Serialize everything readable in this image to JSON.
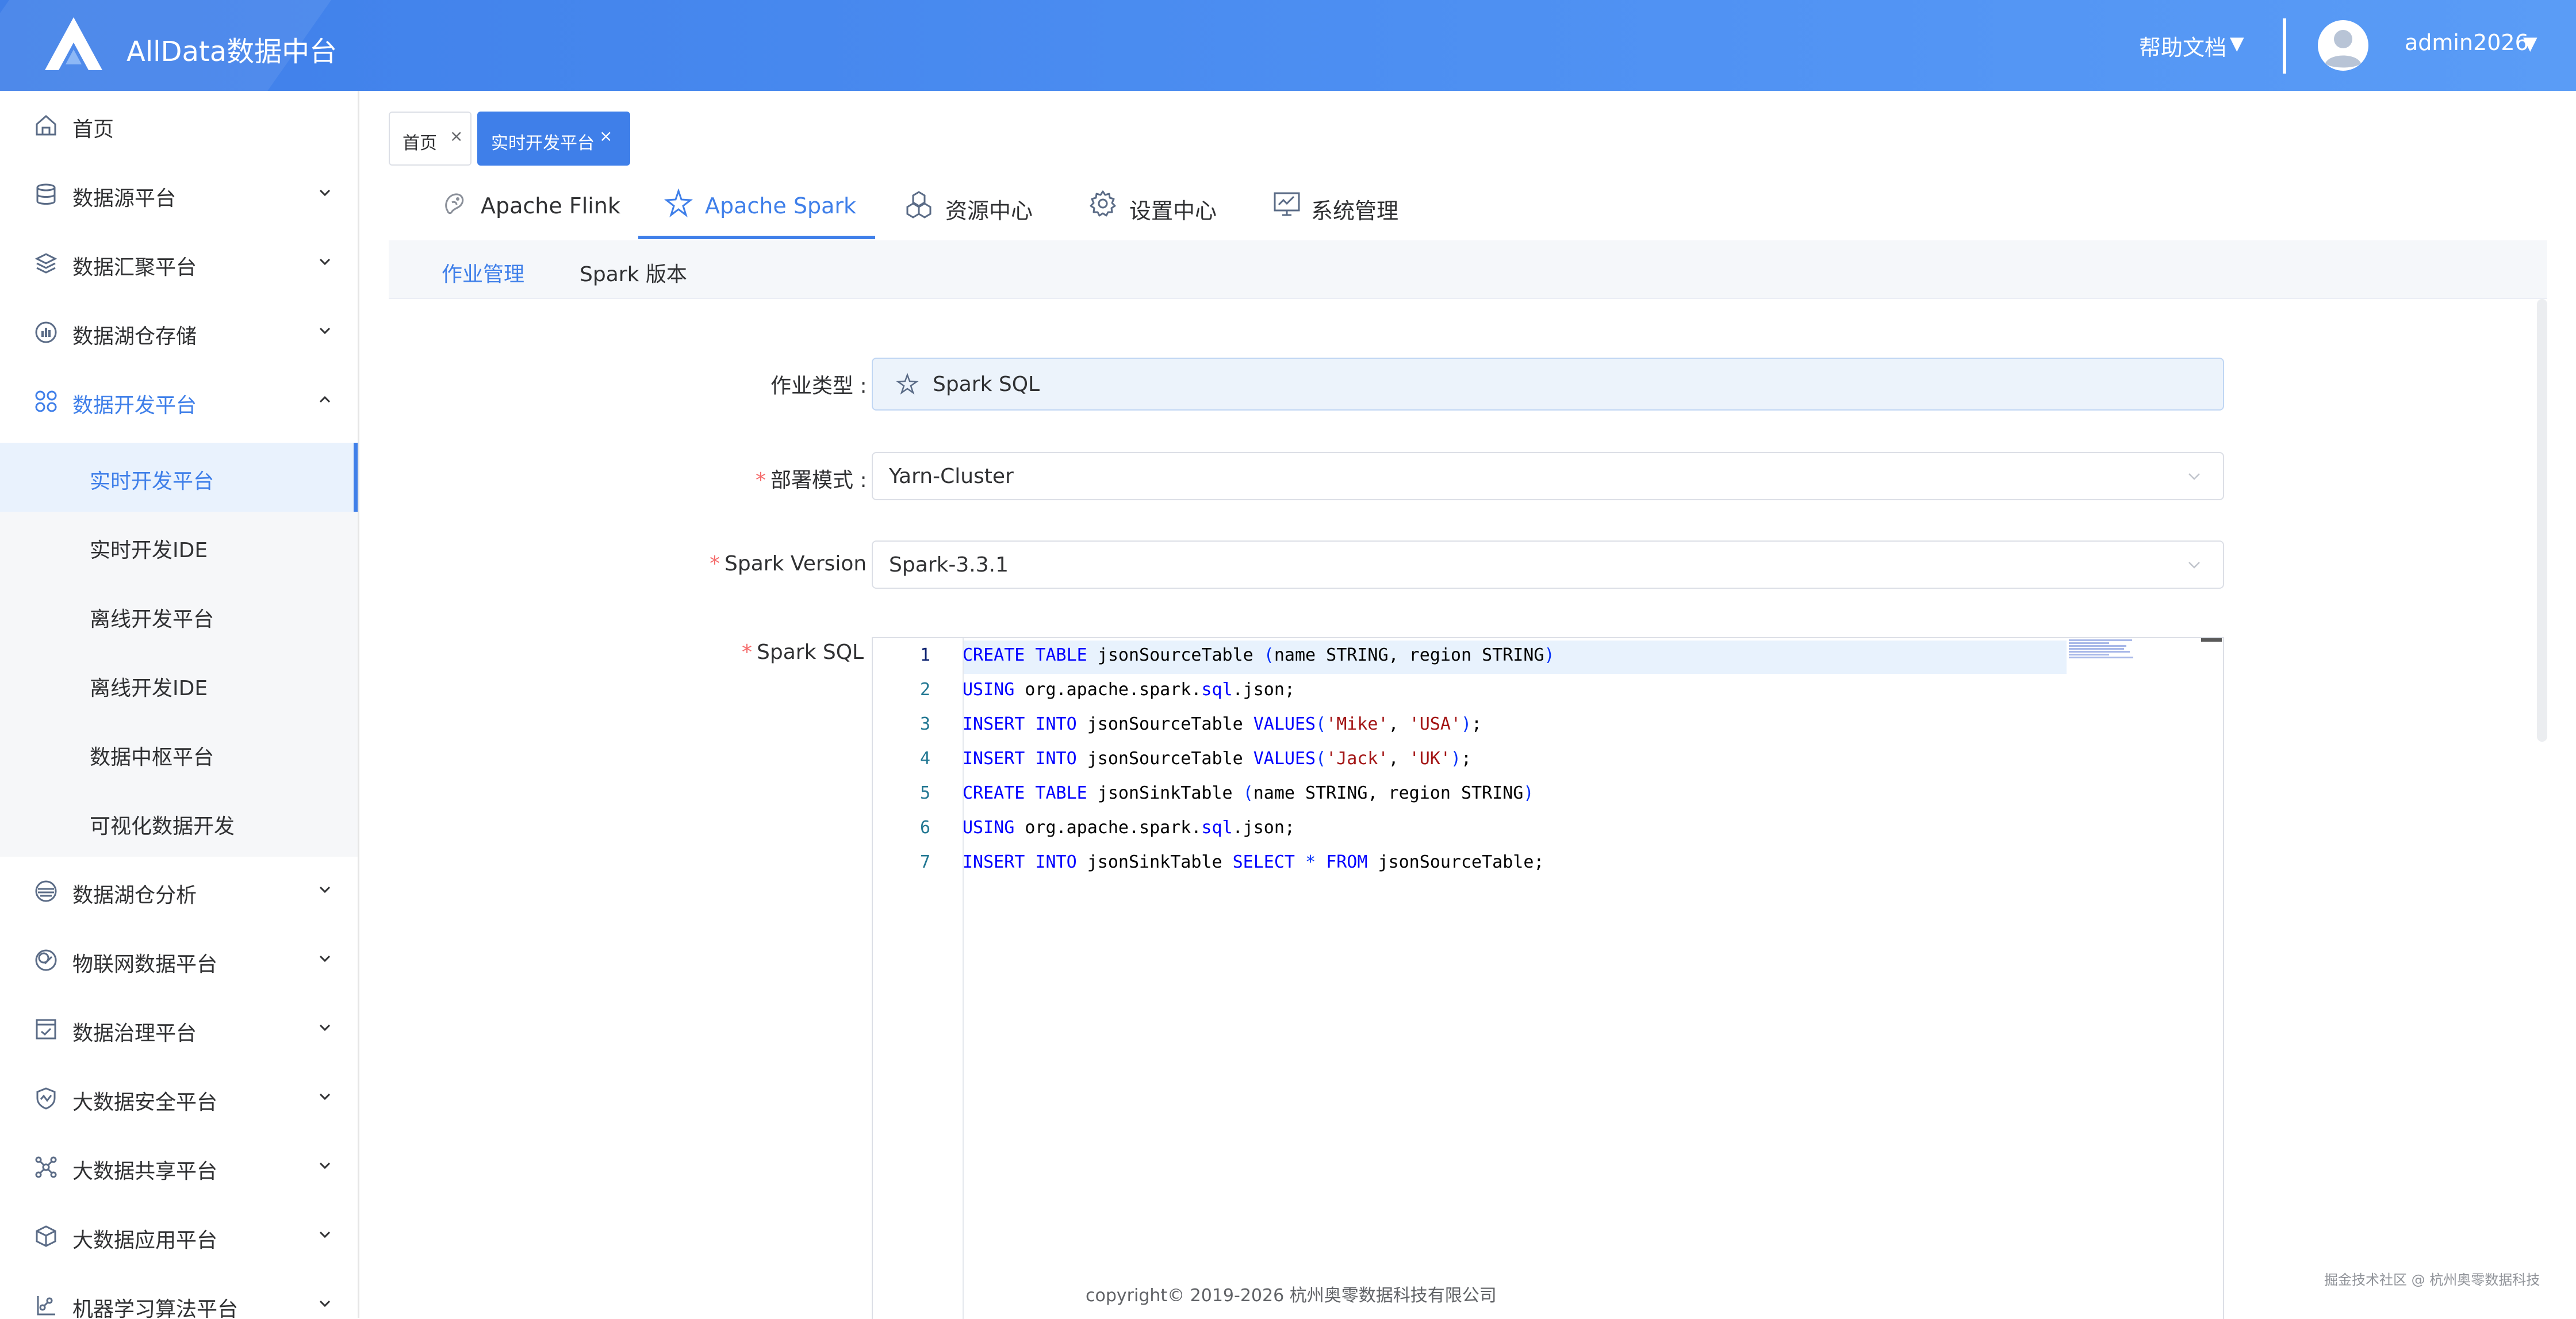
{
  "header": {
    "app_title": "AllData数据中台",
    "help_label": "帮助文档",
    "user_name": "admin2026",
    "caret": "▼"
  },
  "sidebar": {
    "items": [
      {
        "label": "首页",
        "icon": "home-icon"
      },
      {
        "label": "数据源平台",
        "icon": "database-icon"
      },
      {
        "label": "数据汇聚平台",
        "icon": "layers-icon"
      },
      {
        "label": "数据湖仓存储",
        "icon": "bar-chart-icon"
      },
      {
        "label": "数据开发平台",
        "icon": "apps-icon",
        "expanded": true
      },
      {
        "label": "数据湖仓分析",
        "icon": "lake-icon"
      },
      {
        "label": "物联网数据平台",
        "icon": "iot-icon"
      },
      {
        "label": "数据治理平台",
        "icon": "checklist-icon"
      },
      {
        "label": "大数据安全平台",
        "icon": "shield-icon"
      },
      {
        "label": "大数据共享平台",
        "icon": "share-icon"
      },
      {
        "label": "大数据应用平台",
        "icon": "cube-icon"
      },
      {
        "label": "机器学习算法平台",
        "icon": "ml-icon"
      }
    ],
    "subitems": [
      {
        "label": "实时开发平台",
        "active": true
      },
      {
        "label": "实时开发IDE"
      },
      {
        "label": "离线开发平台"
      },
      {
        "label": "离线开发IDE"
      },
      {
        "label": "数据中枢平台"
      },
      {
        "label": "可视化数据开发"
      }
    ]
  },
  "tags": {
    "home": "首页",
    "realtime": "实时开发平台",
    "close": "×"
  },
  "tabs": [
    {
      "label": "Apache Flink",
      "icon": "flink-icon"
    },
    {
      "label": "Apache Spark",
      "icon": "spark-icon",
      "active": true
    },
    {
      "label": "资源中心",
      "icon": "resource-icon"
    },
    {
      "label": "设置中心",
      "icon": "settings-icon"
    },
    {
      "label": "系统管理",
      "icon": "monitor-icon"
    }
  ],
  "subtabs": [
    {
      "label": "作业管理",
      "active": true
    },
    {
      "label": "Spark 版本"
    }
  ],
  "form": {
    "job_type": {
      "label": "作业类型 :",
      "value": "Spark SQL"
    },
    "deploy_mode": {
      "label": "部署模式 :",
      "value": "Yarn-Cluster",
      "required": "*"
    },
    "spark_version": {
      "label": "Spark Version :",
      "value": "Spark-3.3.1",
      "required": "*"
    },
    "spark_sql": {
      "label": "Spark SQL :",
      "required": "*"
    }
  },
  "editor": {
    "line_numbers": [
      "1",
      "2",
      "3",
      "4",
      "5",
      "6",
      "7"
    ],
    "lines": [
      [
        {
          "t": "CREATE TABLE",
          "c": "kw"
        },
        {
          "t": " jsonSourceTable "
        },
        {
          "t": "(",
          "c": "paren"
        },
        {
          "t": "name STRING, region STRING"
        },
        {
          "t": ")",
          "c": "paren"
        }
      ],
      [
        {
          "t": "USING",
          "c": "kw"
        },
        {
          "t": " org.apache.spark."
        },
        {
          "t": "sql",
          "c": "kw"
        },
        {
          "t": ".json;"
        }
      ],
      [
        {
          "t": "INSERT INTO",
          "c": "kw"
        },
        {
          "t": " jsonSourceTable "
        },
        {
          "t": "VALUES",
          "c": "kw"
        },
        {
          "t": "(",
          "c": "paren"
        },
        {
          "t": "'Mike'",
          "c": "str"
        },
        {
          "t": ", "
        },
        {
          "t": "'USA'",
          "c": "str"
        },
        {
          "t": ")",
          "c": "paren"
        },
        {
          "t": ";"
        }
      ],
      [
        {
          "t": "INSERT INTO",
          "c": "kw"
        },
        {
          "t": " jsonSourceTable "
        },
        {
          "t": "VALUES",
          "c": "kw"
        },
        {
          "t": "(",
          "c": "paren"
        },
        {
          "t": "'Jack'",
          "c": "str"
        },
        {
          "t": ", "
        },
        {
          "t": "'UK'",
          "c": "str"
        },
        {
          "t": ")",
          "c": "paren"
        },
        {
          "t": ";"
        }
      ],
      [
        {
          "t": "CREATE TABLE",
          "c": "kw"
        },
        {
          "t": " jsonSinkTable "
        },
        {
          "t": "(",
          "c": "paren"
        },
        {
          "t": "name STRING, region STRING"
        },
        {
          "t": ")",
          "c": "paren"
        }
      ],
      [
        {
          "t": "USING",
          "c": "kw"
        },
        {
          "t": " org.apache.spark."
        },
        {
          "t": "sql",
          "c": "kw"
        },
        {
          "t": ".json;"
        }
      ],
      [
        {
          "t": "INSERT INTO",
          "c": "kw"
        },
        {
          "t": " jsonSinkTable "
        },
        {
          "t": "SELECT",
          "c": "kw"
        },
        {
          "t": " "
        },
        {
          "t": "*",
          "c": "paren"
        },
        {
          "t": " "
        },
        {
          "t": "FROM",
          "c": "kw"
        },
        {
          "t": " jsonSourceTable;"
        }
      ]
    ]
  },
  "footer": {
    "copyright": "copyright© 2019-2026 杭州奥零数据科技有限公司",
    "watermark": "掘金技术社区 @ 杭州奥零数据科技"
  },
  "colors": {
    "accent": "#3f7fe9",
    "required": "#f56c6c",
    "keyword": "#0000ff",
    "string": "#a31515"
  }
}
